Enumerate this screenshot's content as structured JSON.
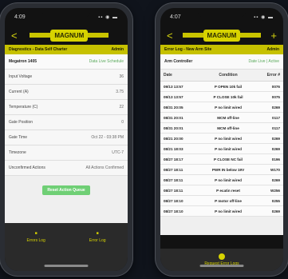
{
  "left": {
    "status_time": "4:09",
    "status_icons": "▪▪ ◉ ▬",
    "back": "<",
    "logo": "MAGNUM",
    "subtitle_left": "Diagnostics - Data Self Charter",
    "subtitle_right": "Admin",
    "rows": [
      {
        "label": "Megatron 1405",
        "value": "Data Live Schedule"
      },
      {
        "label": "Input Voltage",
        "value": "36"
      },
      {
        "label": "Current (A)",
        "value": "3.75"
      },
      {
        "label": "Temperature (C)",
        "value": "22"
      },
      {
        "label": "Gate Position",
        "value": "0"
      },
      {
        "label": "Gate Time",
        "value": "Oct 22 - 03:38 PM"
      },
      {
        "label": "Timezone",
        "value": "UTC-7"
      },
      {
        "label": "Unconfirmed Actions",
        "value": "All Actions Confirmed"
      }
    ],
    "reset_button": "Reset Action Queue",
    "bottom": [
      {
        "label": "Errors Log"
      },
      {
        "label": "Error Log"
      }
    ]
  },
  "right": {
    "status_time": "4:07",
    "status_icons": "▪▪ ◉ ▬",
    "back": "<",
    "logo": "MAGNUM",
    "header_right": "+",
    "subtitle_left": "Error Log - New Arm Site",
    "subtitle_right": "Admin",
    "section_left": "Arm Controller",
    "section_right": "Date Live | Active",
    "table": {
      "headers": [
        "Date",
        "Condition",
        "Error #"
      ],
      "rows": [
        [
          "09/13 13:57",
          "P OPEN 10k fail",
          "0076"
        ],
        [
          "09/13 13:57",
          "P CLOSE 10k fail",
          "0075"
        ],
        [
          "08/31 20:05",
          "P no limit wired",
          "0269"
        ],
        [
          "08/31 20:01",
          "MCM off-line",
          "0117"
        ],
        [
          "08/31 20:01",
          "MCM off-line",
          "0117"
        ],
        [
          "08/21 20:00",
          "P no limit wired",
          "0269"
        ],
        [
          "08/21 18:03",
          "P no limit wired",
          "0269"
        ],
        [
          "08/27 18:17",
          "P CLOSE NC fail",
          "0196"
        ],
        [
          "08/27 18:11",
          "PWR IN below 19V",
          "W170"
        ],
        [
          "08/27 18:11",
          "P no limit wired",
          "0269"
        ],
        [
          "08/27 18:11",
          "P ecatin reset",
          "W256"
        ],
        [
          "08/27 18:10",
          "P motor off-line",
          "0255"
        ],
        [
          "08/27 18:10",
          "P no limit wired",
          "0269"
        ]
      ]
    },
    "request_button": "Request Error Logs"
  }
}
